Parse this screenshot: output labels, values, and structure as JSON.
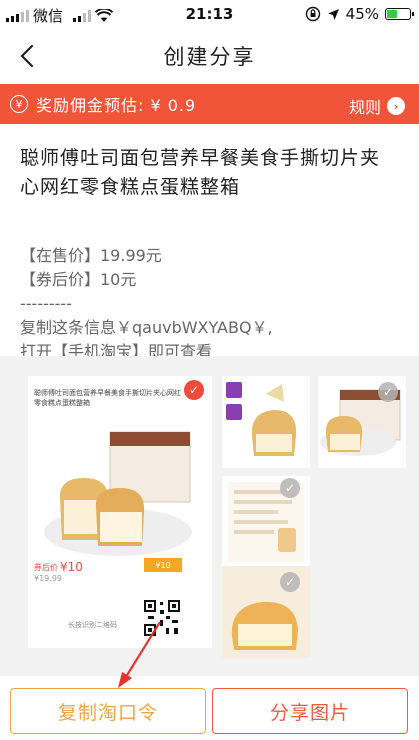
{
  "status_bar": {
    "carrier": "微信",
    "time": "21:13",
    "battery": "45%",
    "battery_level": 0.45
  },
  "nav": {
    "title": "创建分享"
  },
  "reward": {
    "text": "奖励佣金预估: ¥ 0.9",
    "rules_label": "规则",
    "coin_symbol": "¥"
  },
  "product": {
    "title": "聪师傅吐司面包营养早餐美食手撕切片夹心网红零食糕点蛋糕整箱",
    "price_line": "【在售价】19.99元",
    "coupon_line": "【券后价】10元",
    "divider": "---------",
    "copy_line": "复制这条信息￥qauvbWXYABQ￥,",
    "open_line": "打开【手机淘宝】即可查看"
  },
  "gallery": {
    "main_caption": "聪师傅吐司面包营养早餐美食手撕切片夹心网红零食糕点蛋糕整箱",
    "main_price_label": "券后价",
    "main_price": "¥10",
    "main_orig_price": "¥19.99",
    "main_coupon": "¥10",
    "qr_note": "长按识别二维码",
    "thumbs": [
      "thumb-1",
      "thumb-2",
      "thumb-3"
    ]
  },
  "actions": {
    "copy_label": "复制淘口令",
    "share_label": "分享图片"
  },
  "colors": {
    "brand_red": "#f0553a",
    "copy_orange": "#f0a640"
  }
}
